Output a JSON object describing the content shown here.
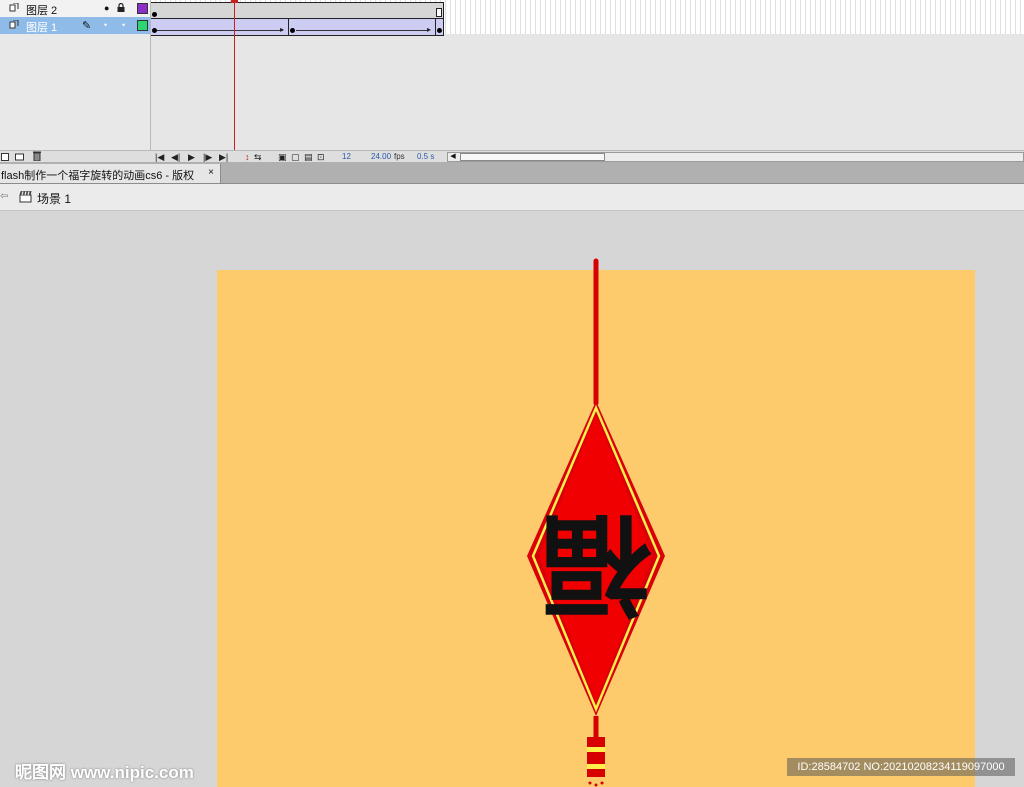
{
  "timeline": {
    "layers": [
      {
        "name": "图层 2",
        "color": "#8b2fc9",
        "locked": true,
        "selected": false
      },
      {
        "name": "图层 1",
        "color": "#2ed573",
        "locked": false,
        "selected": true
      }
    ],
    "controls": {
      "current_frame": "12",
      "frame_rate": "24.00",
      "frame_rate_unit": "fps",
      "elapsed_time": "0.5 s"
    }
  },
  "document": {
    "tab_title": "flash制作一个福字旋转的动画cs6 - 版权",
    "close_label": "×"
  },
  "edit_bar": {
    "scene_label": "场景 1"
  },
  "stage": {
    "background_color": "#fecb6c",
    "ornament_red": "#e60000",
    "ornament_border": "#ffef4a",
    "character": "福"
  },
  "watermark": {
    "logo": "昵图网 www.nipic.com",
    "id_text": "ID:28584702 NO:20210208234119097000"
  }
}
